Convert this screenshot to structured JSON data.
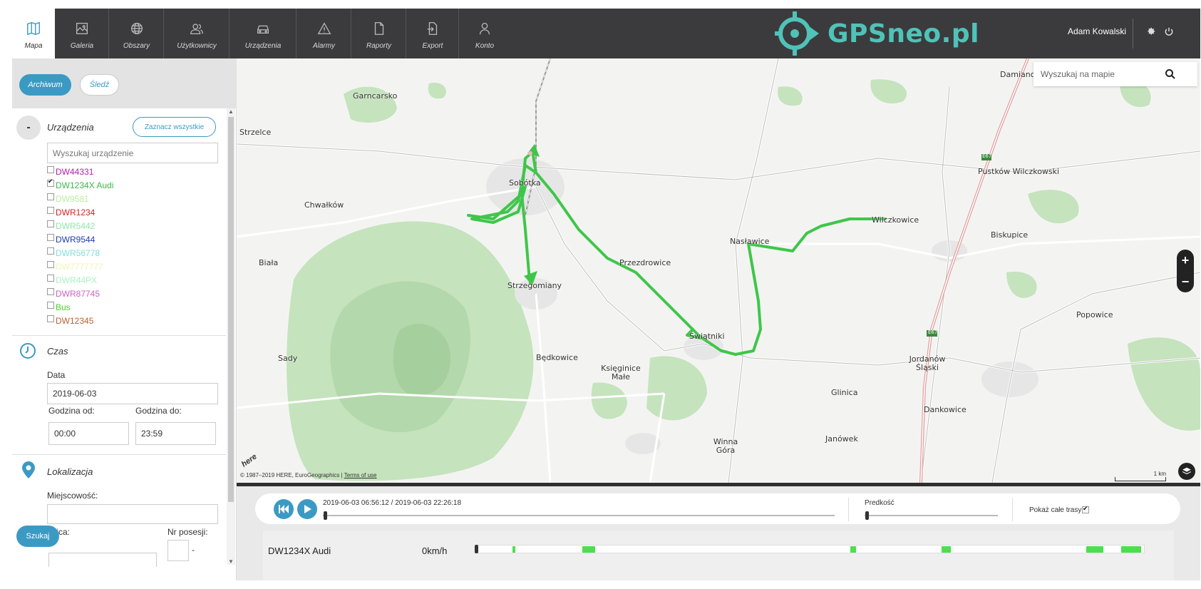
{
  "nav": {
    "items": [
      {
        "label": "Mapa",
        "icon": "map-icon"
      },
      {
        "label": "Galeria",
        "icon": "image-icon"
      },
      {
        "label": "Obszary",
        "icon": "globe-icon"
      },
      {
        "label": "Użytkownicy",
        "icon": "users-icon"
      },
      {
        "label": "Urządzenia",
        "icon": "car-icon"
      },
      {
        "label": "Alarmy",
        "icon": "warning-icon"
      },
      {
        "label": "Raporty",
        "icon": "document-icon"
      },
      {
        "label": "Export",
        "icon": "export-icon"
      },
      {
        "label": "Konto",
        "icon": "user-icon"
      }
    ],
    "brand": "GPSneo.pl",
    "user_name": "Adam Kowalski",
    "accent": "#4fc3b8",
    "bar_color": "#3b3b3d"
  },
  "sidebar": {
    "mode_archive": "Archiwum",
    "mode_track": "Śledź",
    "devices_title": "Urządzenia",
    "collapse_label": "-",
    "select_all": "Zaznacz wszystkie",
    "device_search_placeholder": "Wyszukaj urządzenie",
    "devices": [
      {
        "name": "DW44331",
        "color": "#b51fa6",
        "checked": false
      },
      {
        "name": "DW1234X Audi",
        "color": "#3cb84a",
        "checked": true
      },
      {
        "name": "DW9581",
        "color": "#b9ef9f",
        "checked": false
      },
      {
        "name": "DWR1234",
        "color": "#d42424",
        "checked": false
      },
      {
        "name": "DWR5442",
        "color": "#8ee8a8",
        "checked": false
      },
      {
        "name": "DWR9544",
        "color": "#1f3bb0",
        "checked": false
      },
      {
        "name": "DWR56778",
        "color": "#7fe0d8",
        "checked": false
      },
      {
        "name": "DW7777777",
        "color": "#f2f4b8",
        "checked": false
      },
      {
        "name": "DWR44PX",
        "color": "#a9f0c8",
        "checked": false
      },
      {
        "name": "DWR87745",
        "color": "#d060c0",
        "checked": false
      },
      {
        "name": "Bus",
        "color": "#4ad12a",
        "checked": false
      },
      {
        "name": "DW12345",
        "color": "#c0602a",
        "checked": false
      }
    ],
    "time_title": "Czas",
    "date_label": "Data",
    "date_value": "2019-06-03",
    "from_label": "Godzina od:",
    "from_value": "00:00",
    "to_label": "Godzina do:",
    "to_value": "23:59",
    "location_title": "Lokalizacja",
    "city_label": "Miejscowość:",
    "city_value": "",
    "street_label": "Ulica:",
    "street_value": "",
    "number_label": "Nr posesji:",
    "number_value": "",
    "number_dash": "-",
    "search_button": "Szukaj"
  },
  "map": {
    "search_placeholder": "Wyszukaj na mapie",
    "zoom_in": "+",
    "zoom_out": "−",
    "attribution": "© 1987–2019 HERE, EuroGeographics |",
    "terms": "Terms of use",
    "here_logo": "here",
    "scale_label": "1 km",
    "route_color": "#3fc64a",
    "places": [
      "Damianowice",
      "Garncarsko",
      "Strzelce",
      "Sobótka",
      "Chwałków",
      "Nasławice",
      "Wilczkowice",
      "Pustków Wilczkowski",
      "Biskupice",
      "Biała",
      "Przezdrowice",
      "Strzegomiany",
      "Popowice",
      "Sady",
      "Świątniki",
      "Będkowice",
      "Księginice Małe",
      "Jordanów Śląski",
      "Glinica",
      "Dankowice",
      "Janówek",
      "Winna Góra"
    ],
    "road_labels": [
      "E67",
      "E67"
    ]
  },
  "playback": {
    "range_text": "2019-06-03 06:56:12 / 2019-06-03 22:26:18",
    "speed_label": "Predkość",
    "show_all_label": "Pokaż całe trasy",
    "show_all_checked": true,
    "device": "DW1234X Audi",
    "speed_value": "0km/h",
    "timeline_color": "#4be04b"
  }
}
